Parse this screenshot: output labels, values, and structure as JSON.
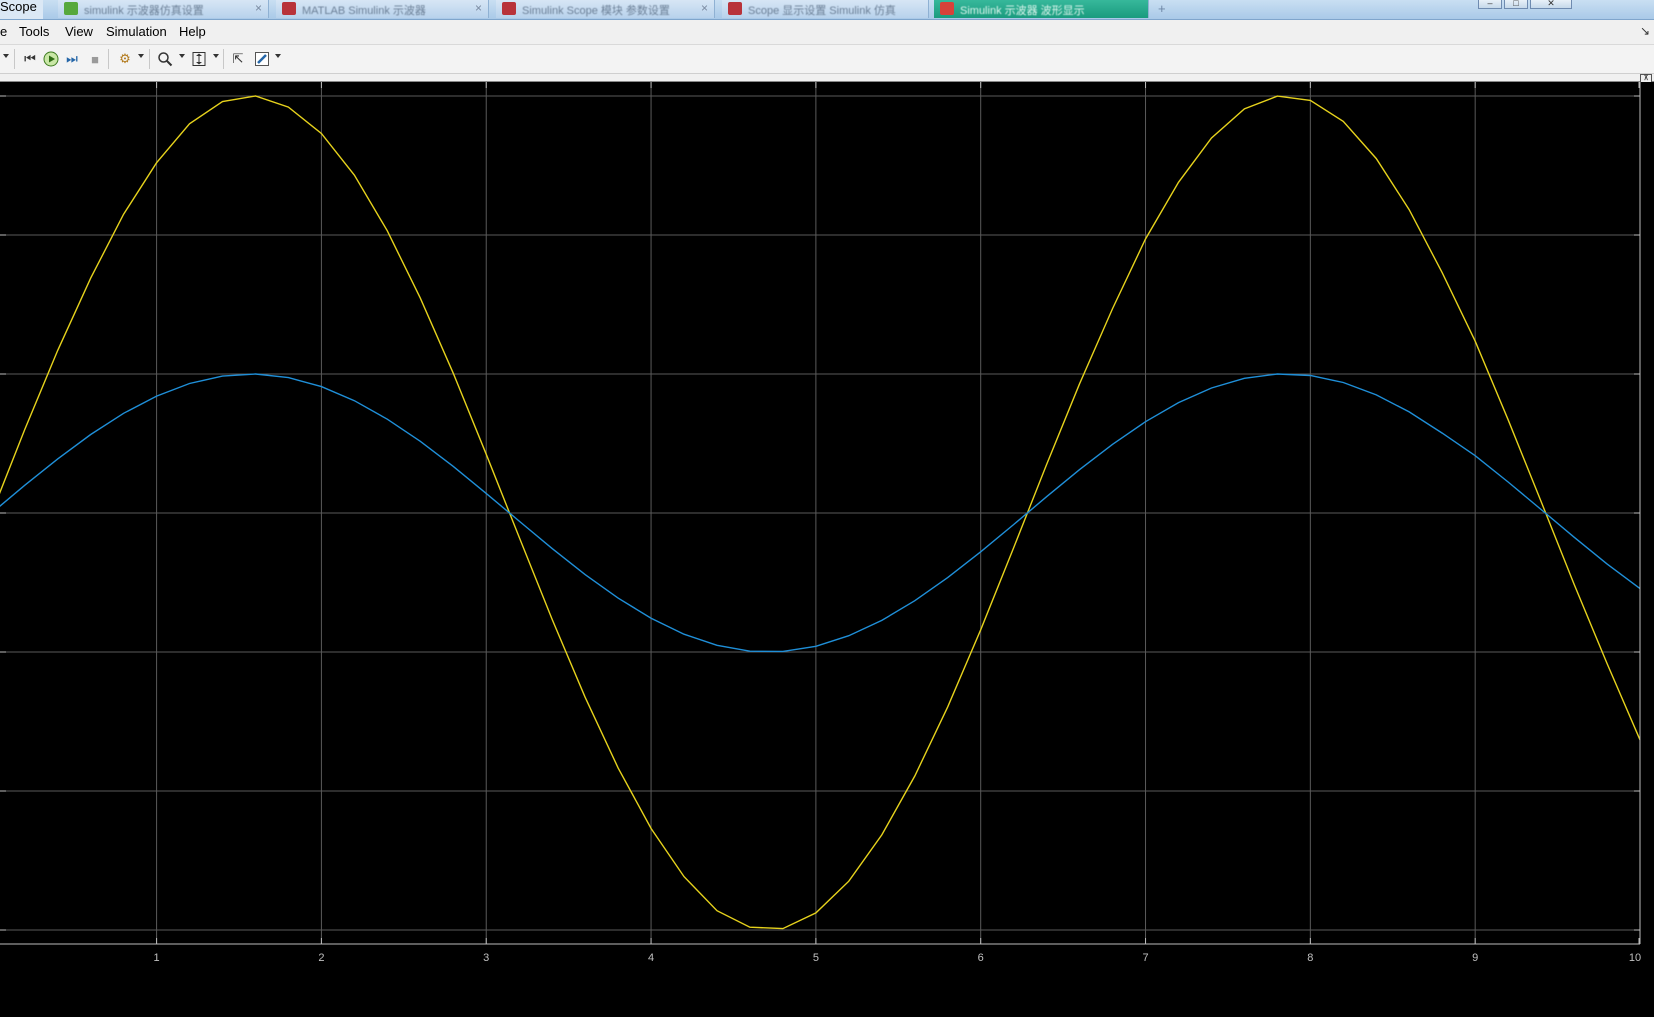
{
  "window": {
    "title": "Scope",
    "tabs": [
      {
        "text": "simulink 示波器仿真设置",
        "color": "#56a83c",
        "active": false
      },
      {
        "text": "MATLAB Simulink 示波器",
        "color": "#b8323a",
        "active": false
      },
      {
        "text": "Simulink Scope 模块 参数设置",
        "color": "#b8323a",
        "active": false
      },
      {
        "text": "Scope 显示设置 Simulink 仿真",
        "color": "#b8323a",
        "active": false
      },
      {
        "text": "Simulink 示波器 波形显示",
        "color": "#1a9b7e",
        "active": true
      }
    ],
    "new_tab_symbol": "+",
    "tab_close_symbol": "×"
  },
  "menu": {
    "items": [
      "e",
      "Tools",
      "View",
      "Simulation",
      "Help"
    ],
    "dock_arrow": "↘"
  },
  "toolbar": {
    "buttons": [
      {
        "name": "dropdown-arrow-icon",
        "glyph": "▾"
      },
      {
        "name": "step-back-icon",
        "glyph": "⏮"
      },
      {
        "name": "run-icon",
        "glyph": "▶"
      },
      {
        "name": "step-forward-icon",
        "glyph": "⏭"
      },
      {
        "name": "stop-icon",
        "glyph": "■"
      },
      {
        "name": "signal-settings-icon",
        "glyph": "⚙"
      },
      {
        "name": "zoom-icon",
        "glyph": "🔍"
      },
      {
        "name": "scale-axes-icon",
        "glyph": "⇕"
      },
      {
        "name": "cursor-measure-icon",
        "glyph": "⇱"
      },
      {
        "name": "style-icon",
        "glyph": "✎"
      }
    ]
  },
  "colors": {
    "plot_background": "#000000",
    "grid": "#5a5a5a",
    "axis_text": "#c0c0c0",
    "series_1": "#e6d21c",
    "series_2": "#1f8fd8"
  },
  "chart_data": {
    "type": "line",
    "title": "",
    "xlabel": "",
    "ylabel": "",
    "xlim": [
      0.05,
      10
    ],
    "ylim": [
      -3,
      3
    ],
    "x_ticks": [
      1,
      2,
      3,
      4,
      5,
      6,
      7,
      8,
      9,
      10
    ],
    "x_tick_labels": [
      "1",
      "2",
      "3",
      "4",
      "5",
      "6",
      "7",
      "8",
      "9",
      "10"
    ],
    "y_ticks": [
      -3,
      -2,
      -1,
      0,
      1,
      2,
      3
    ],
    "grid": true,
    "legend": "none",
    "series": [
      {
        "x": [
          0.0,
          0.2,
          0.4,
          0.6,
          0.8,
          1.0,
          1.2,
          1.4,
          1.6,
          1.8,
          2.0,
          2.2,
          2.4,
          2.6,
          2.8,
          3.0,
          3.2,
          3.4,
          3.6,
          3.8,
          4.0,
          4.2,
          4.4,
          4.6,
          4.8,
          5.0,
          5.2,
          5.4,
          5.6,
          5.8,
          6.0,
          6.2,
          6.4,
          6.6,
          6.8,
          7.0,
          7.2,
          7.4,
          7.6,
          7.8,
          8.0,
          8.2,
          8.4,
          8.6,
          8.8,
          9.0,
          9.2,
          9.4,
          9.6,
          9.8,
          10.0
        ],
        "values": [
          0.0,
          0.6,
          1.17,
          1.69,
          2.15,
          2.52,
          2.8,
          2.96,
          3.0,
          2.92,
          2.73,
          2.43,
          2.03,
          1.546,
          1.005,
          0.423,
          -0.175,
          -0.766,
          -1.325,
          -1.834,
          -2.27,
          -2.616,
          -2.861,
          -2.98,
          -2.99,
          -2.877,
          -2.649,
          -2.316,
          -1.892,
          -1.395,
          -0.84,
          -0.249,
          0.349,
          0.93,
          1.471,
          1.971,
          2.379,
          2.698,
          2.907,
          2.999,
          2.968,
          2.817,
          2.55,
          2.182,
          1.729,
          1.236,
          0.671,
          0.083,
          -0.513,
          -1.082,
          -1.632
        ]
      },
      {
        "x": [
          0.0,
          0.2,
          0.4,
          0.6,
          0.8,
          1.0,
          1.2,
          1.4,
          1.6,
          1.8,
          2.0,
          2.2,
          2.4,
          2.6,
          2.8,
          3.0,
          3.2,
          3.4,
          3.6,
          3.8,
          4.0,
          4.2,
          4.4,
          4.6,
          4.8,
          5.0,
          5.2,
          5.4,
          5.6,
          5.8,
          6.0,
          6.2,
          6.4,
          6.6,
          6.8,
          7.0,
          7.2,
          7.4,
          7.6,
          7.8,
          8.0,
          8.2,
          8.4,
          8.6,
          8.8,
          9.0,
          9.2,
          9.4,
          9.6,
          9.8,
          10.0
        ],
        "values": [
          0.0,
          0.199,
          0.389,
          0.565,
          0.717,
          0.841,
          0.932,
          0.985,
          1.0,
          0.974,
          0.909,
          0.808,
          0.675,
          0.516,
          0.335,
          0.141,
          -0.058,
          -0.256,
          -0.443,
          -0.612,
          -0.757,
          -0.872,
          -0.952,
          -0.994,
          -0.996,
          -0.959,
          -0.883,
          -0.773,
          -0.631,
          -0.465,
          -0.279,
          -0.083,
          0.117,
          0.312,
          0.494,
          0.657,
          0.794,
          0.899,
          0.969,
          1.0,
          0.989,
          0.939,
          0.85,
          0.727,
          0.575,
          0.412,
          0.223,
          0.025,
          -0.174,
          -0.366,
          -0.544
        ]
      }
    ]
  }
}
